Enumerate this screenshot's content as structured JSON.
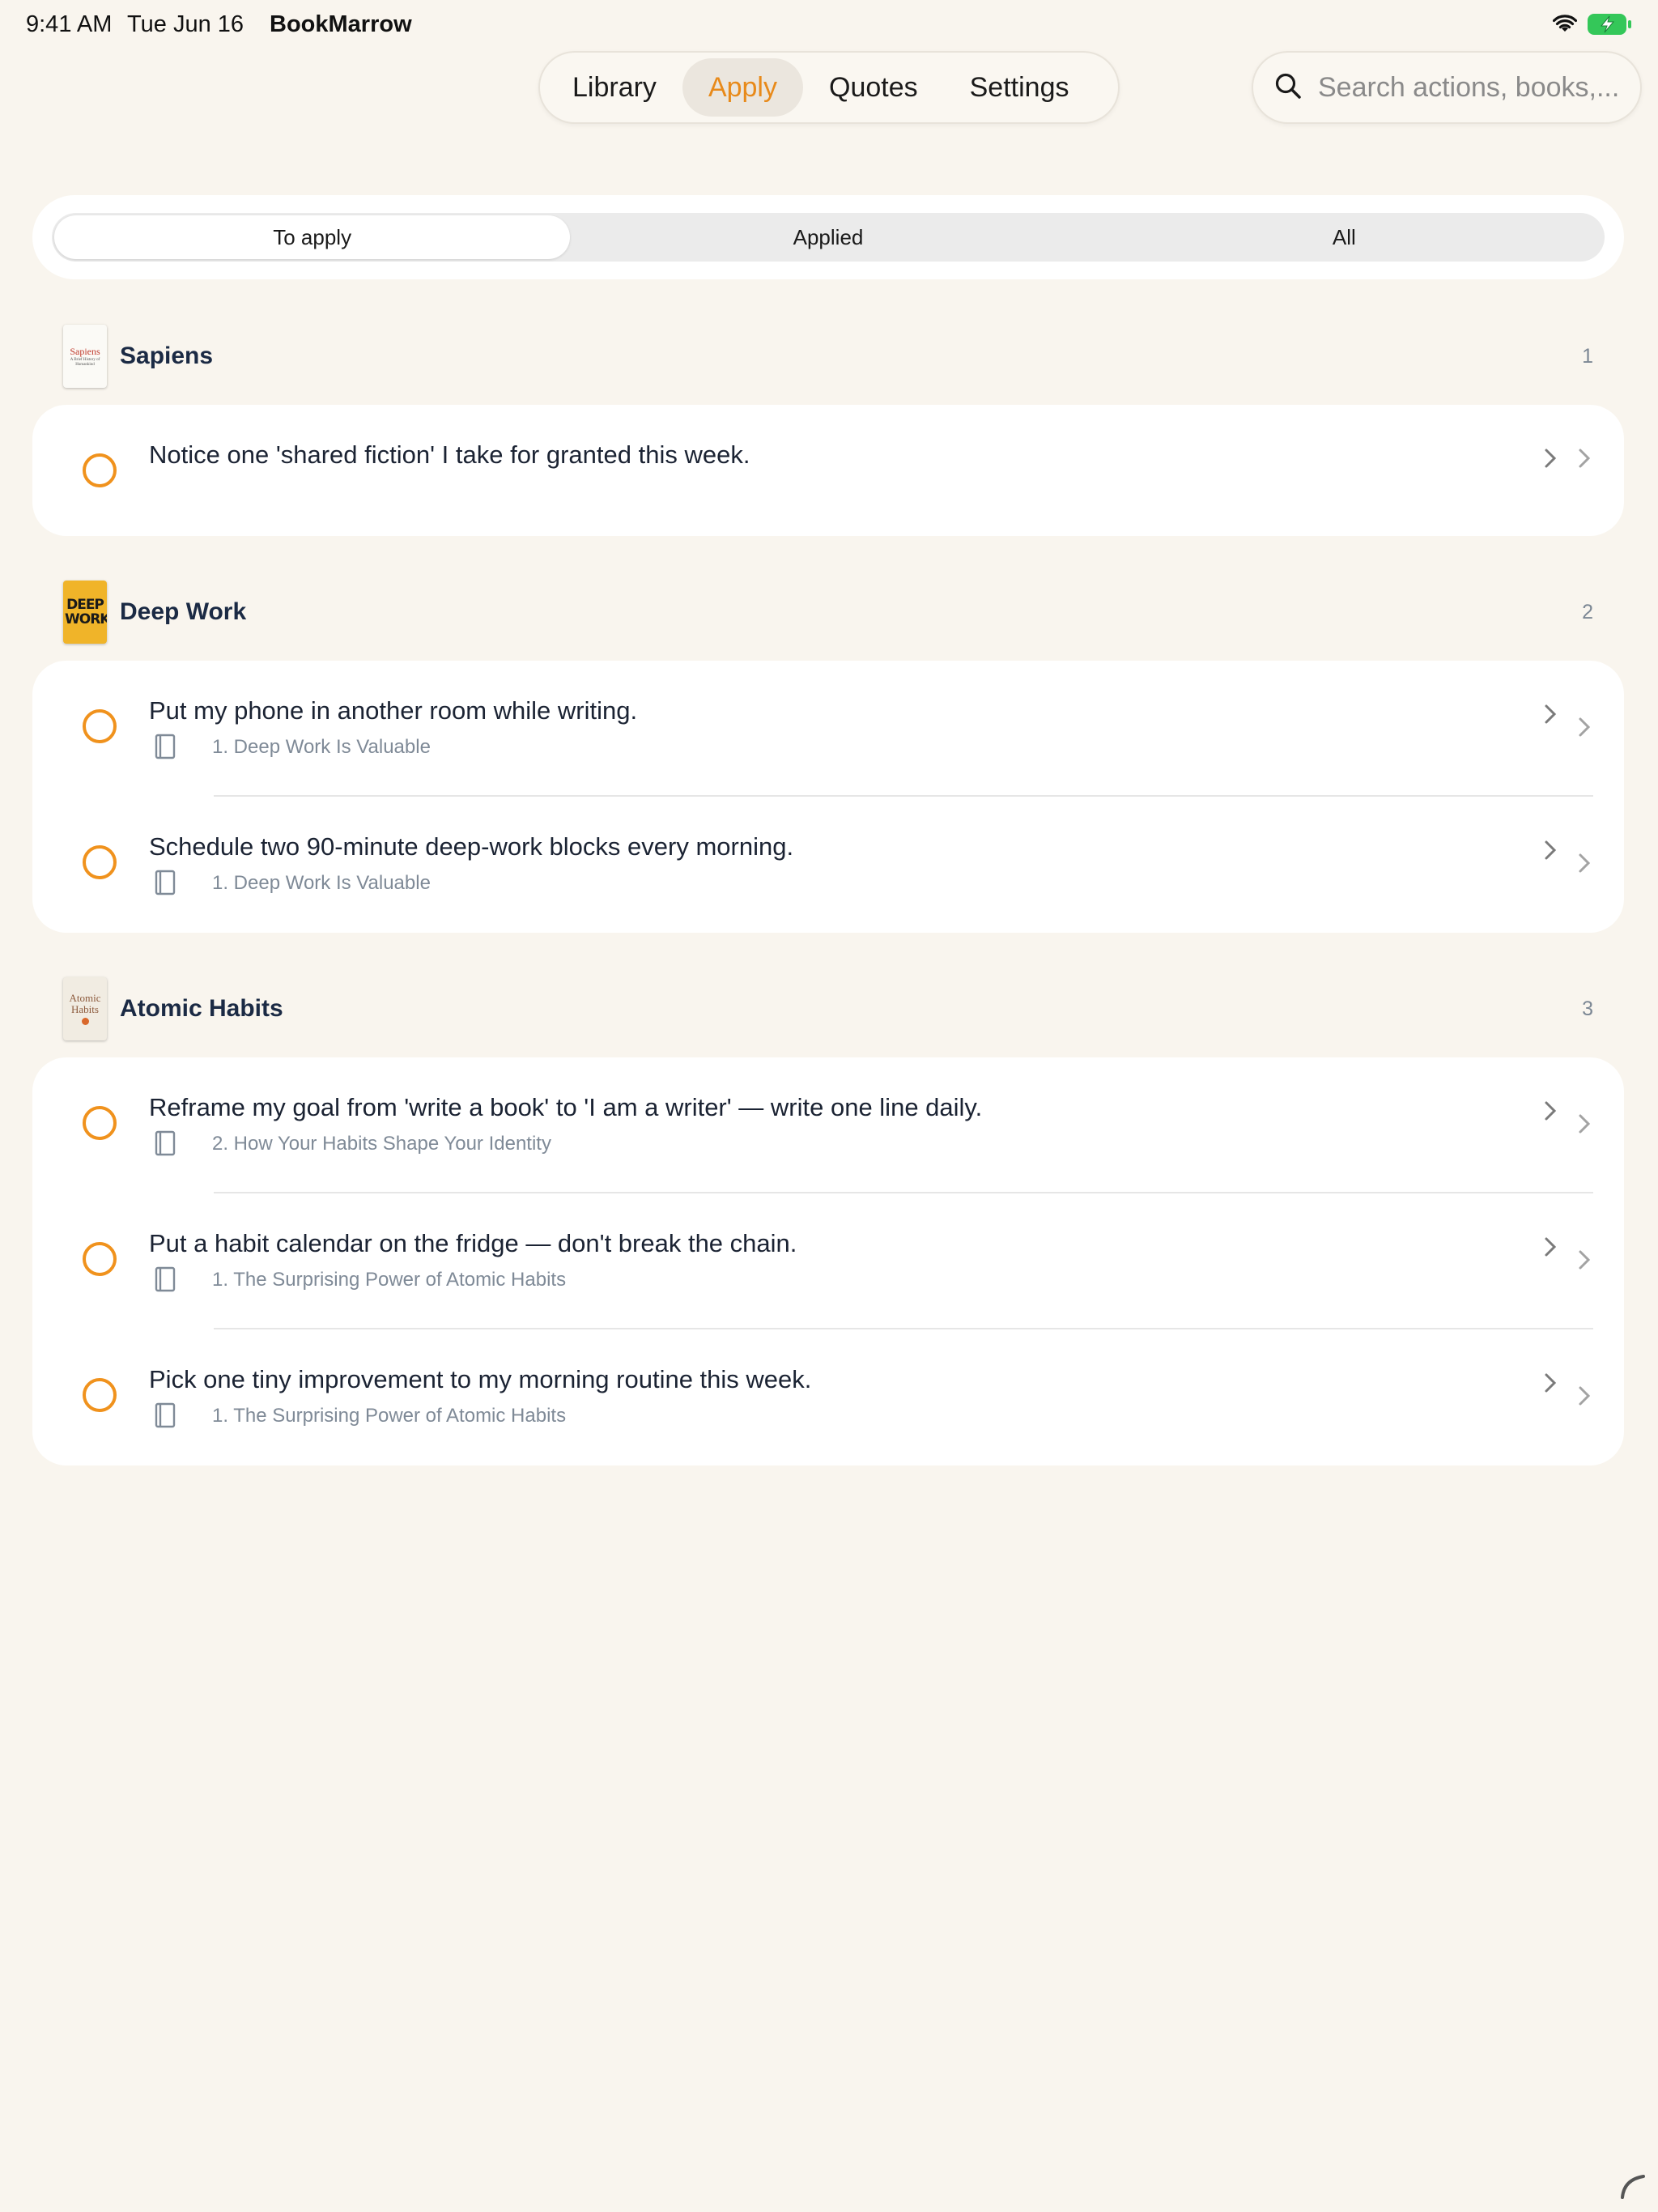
{
  "status_bar": {
    "time": "9:41 AM",
    "date": "Tue Jun 16",
    "app_name": "BookMarrow"
  },
  "nav": {
    "tabs": [
      {
        "label": "Library"
      },
      {
        "label": "Apply",
        "active": true
      },
      {
        "label": "Quotes"
      },
      {
        "label": "Settings"
      }
    ]
  },
  "search": {
    "placeholder": "Search actions, books,..."
  },
  "filter": {
    "segments": [
      {
        "label": "To apply",
        "active": true
      },
      {
        "label": "Applied"
      },
      {
        "label": "All"
      }
    ]
  },
  "colors": {
    "accent": "#f0921d",
    "background": "#f9f5ee",
    "card": "#ffffff"
  },
  "sections": [
    {
      "book": "Sapiens",
      "cover_text": "Sapiens",
      "cover_subtitle": "A Brief History of Humankind",
      "count": "1",
      "actions": [
        {
          "text": "Notice one 'shared fiction' I take for granted this week.",
          "chapter": ""
        }
      ]
    },
    {
      "book": "Deep Work",
      "cover_text": "DEEP WORK",
      "count": "2",
      "actions": [
        {
          "text": "Put my phone in another room while writing.",
          "chapter": "1. Deep Work Is Valuable"
        },
        {
          "text": "Schedule two 90-minute deep-work blocks every morning.",
          "chapter": "1. Deep Work Is Valuable"
        }
      ]
    },
    {
      "book": "Atomic Habits",
      "cover_text": "Atomic Habits",
      "count": "3",
      "actions": [
        {
          "text": "Reframe my goal from 'write a book' to 'I am a writer' — write one line daily.",
          "chapter": "2. How Your Habits Shape Your Identity"
        },
        {
          "text": "Put a habit calendar on the fridge — don't break the chain.",
          "chapter": "1. The Surprising Power of Atomic Habits"
        },
        {
          "text": "Pick one tiny improvement to my morning routine this week.",
          "chapter": "1. The Surprising Power of Atomic Habits"
        }
      ]
    }
  ]
}
